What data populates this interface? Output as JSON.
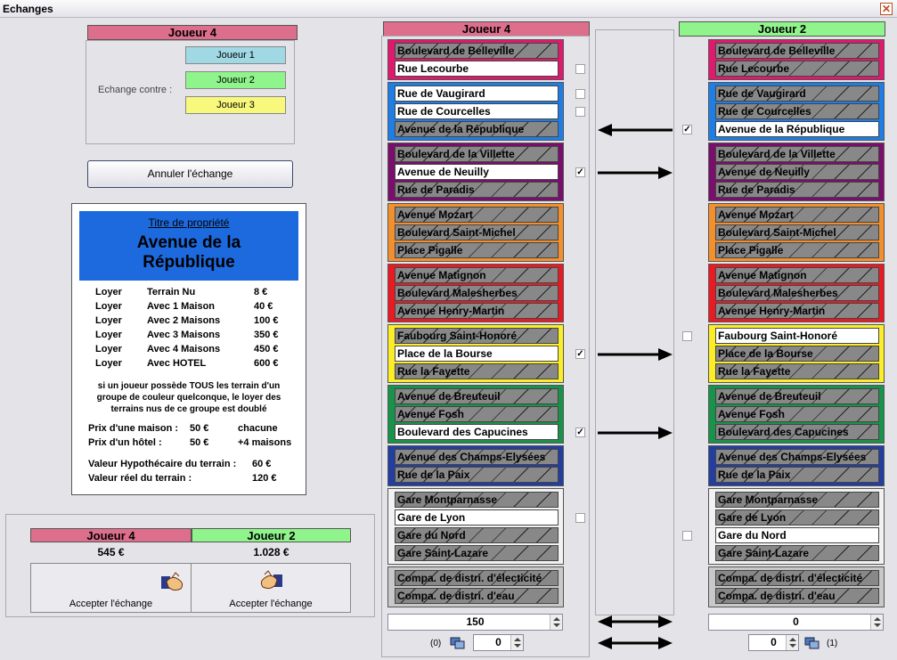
{
  "window": {
    "title": "Echanges"
  },
  "left": {
    "player_header": "Joueur 4",
    "exchange_label": "Echange contre :",
    "options": [
      {
        "label": "Joueur 1",
        "color": "#a0d8e4"
      },
      {
        "label": "Joueur 2",
        "color": "#8ff48c"
      },
      {
        "label": "Joueur 3",
        "color": "#f8f87c"
      }
    ],
    "cancel_button": "Annuler l'échange"
  },
  "card": {
    "subtitle": "Titre de propriété",
    "name_line1": "Avenue de la",
    "name_line2": "République",
    "header_color": "#1d6adf",
    "rent_rows": [
      {
        "label": "Loyer",
        "desc": "Terrain Nu",
        "value": "8 €"
      },
      {
        "label": "Loyer",
        "desc": "Avec 1 Maison",
        "value": "40 €"
      },
      {
        "label": "Loyer",
        "desc": "Avec 2 Maisons",
        "value": "100 €"
      },
      {
        "label": "Loyer",
        "desc": "Avec 3 Maisons",
        "value": "350 €"
      },
      {
        "label": "Loyer",
        "desc": "Avec 4 Maisons",
        "value": "450 €"
      },
      {
        "label": "Loyer",
        "desc": "Avec HOTEL",
        "value": "600 €"
      }
    ],
    "rule": [
      "si un joueur possède TOUS les terrain d'un",
      "groupe de couleur quelconque, le loyer des",
      "terrains nus de ce groupe est doublé"
    ],
    "house_price_label": "Prix d'une maison :",
    "house_price": "50 €",
    "house_price_note": "chacune",
    "hotel_price_label": "Prix d'un hôtel :",
    "hotel_price": "50 €",
    "hotel_price_note": "+4 maisons",
    "mortgage_label": "Valeur Hypothécaire du terrain :",
    "mortgage_value": "60 €",
    "real_label": "Valeur réel du terrain :",
    "real_value": "120 €"
  },
  "summary": {
    "p1_name": "Joueur 4",
    "p1_money": "545 €",
    "p2_name": "Joueur 2",
    "p2_money": "1.028 €",
    "accept_label_1": "Accepter l'échange",
    "accept_label_2": "Accepter l'échange"
  },
  "col_left_header": "Joueur 4",
  "col_right_header": "Joueur 2",
  "groups": [
    {
      "color": "#e0186e",
      "props": [
        "Boulevard de Belleville",
        "Rue Lecourbe"
      ]
    },
    {
      "color": "#1e7ee6",
      "props": [
        "Rue de Vaugirard",
        "Rue de Courcelles",
        "Avenue de la République"
      ]
    },
    {
      "color": "#7a0e6c",
      "props": [
        "Boulevard de la Villette",
        "Avenue de Neuilly",
        "Rue de Paradis"
      ]
    },
    {
      "color": "#f4902c",
      "props": [
        "Avenue Mozart",
        "Boulevard Saint-Michel",
        "Place Pigalle"
      ]
    },
    {
      "color": "#ea1a24",
      "props": [
        "Avenue Matignon",
        "Boulevard Malesherbes",
        "Avenue Henry-Martin"
      ]
    },
    {
      "color": "#fcee26",
      "props": [
        "Faubourg Saint-Honoré",
        "Place de la Bourse",
        "Rue la Fayette"
      ]
    },
    {
      "color": "#18944a",
      "props": [
        "Avenue de Breuteuil",
        "Avenue Fosh",
        "Boulevard des Capucines"
      ]
    },
    {
      "color": "#213ea0",
      "props": [
        "Avenue des Champs-Elysées",
        "Rue de la Paix"
      ]
    },
    {
      "color": "#f2f2f2",
      "props": [
        "Gare Montparnasse",
        "Gare de Lyon",
        "Gare du Nord",
        "Gare Saint-Lazare"
      ]
    },
    {
      "color": "#c8c8c8",
      "props": [
        "Compa. de distri. d'électicité",
        "Compa. de distri. d'eau"
      ]
    }
  ],
  "bottom": {
    "left_money": "150",
    "right_money": "0",
    "left_count": "(0)",
    "left_cards": "0",
    "right_cards": "0",
    "right_count": "(1)"
  }
}
